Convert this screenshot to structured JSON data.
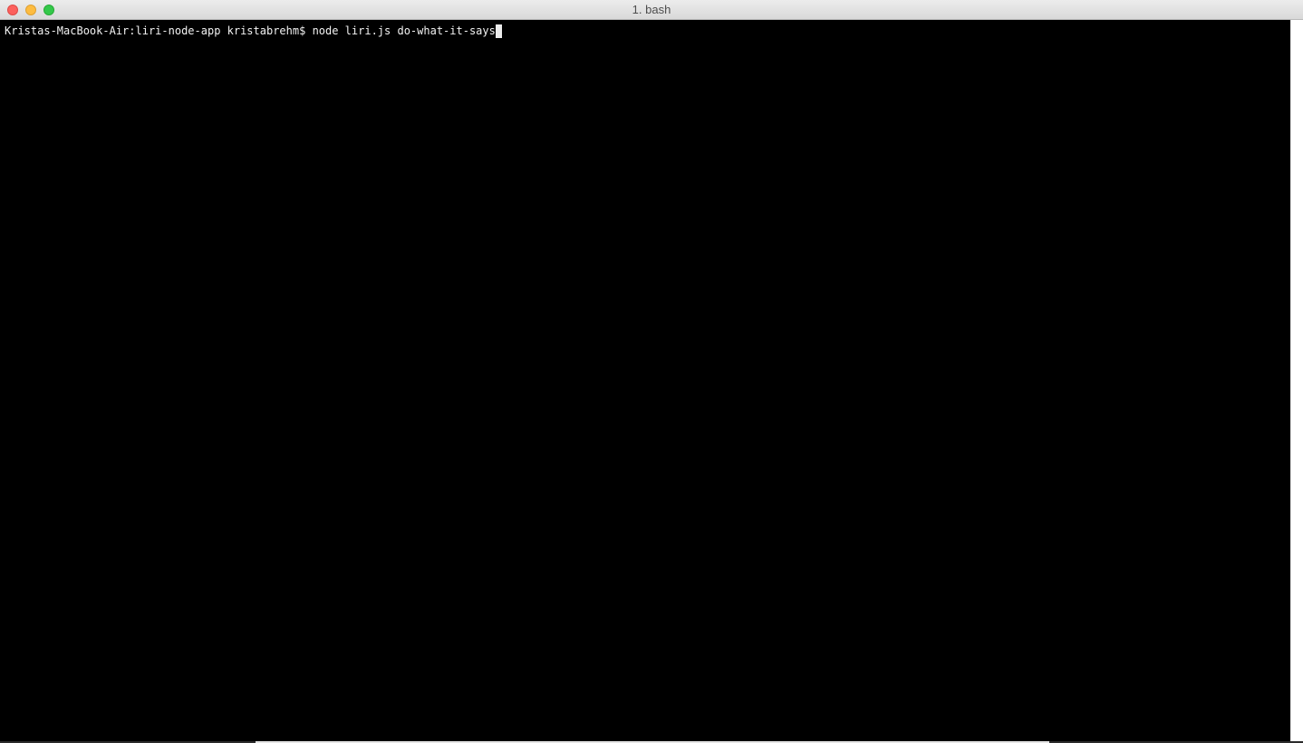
{
  "window": {
    "title": "1. bash"
  },
  "terminal": {
    "prompt": "Kristas-MacBook-Air:liri-node-app kristabrehm$ ",
    "command": "node liri.js do-what-it-says"
  },
  "colors": {
    "background": "#000000",
    "text": "#f2f2f2",
    "close": "#fc605c",
    "minimize": "#fdbc40",
    "zoom": "#34c84a"
  }
}
